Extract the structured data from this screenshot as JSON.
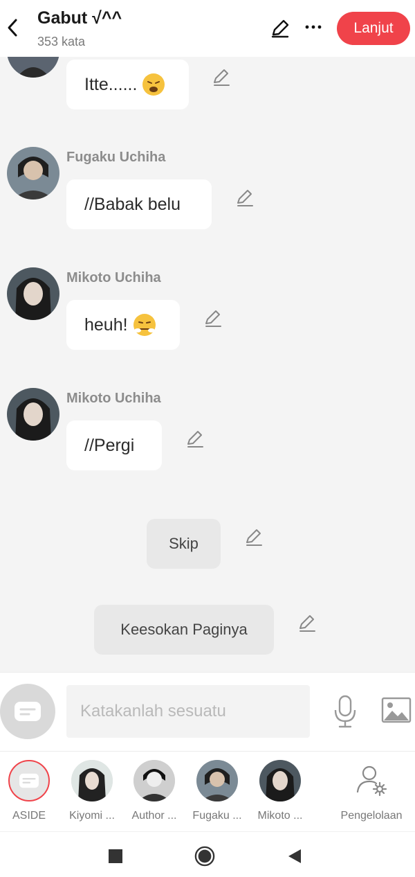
{
  "header": {
    "title": "Gabut √^^",
    "word_count": "353 kata",
    "next_label": "Lanjut"
  },
  "messages": [
    {
      "speaker": "",
      "text": "Itte......",
      "emoji": "weary-face"
    },
    {
      "speaker": "Fugaku Uchiha",
      "text": "//Babak belu"
    },
    {
      "speaker": "Mikoto Uchiha",
      "text": "heuh!",
      "emoji": "face-with-steam"
    },
    {
      "speaker": "Mikoto Uchiha",
      "text": "//Pergi"
    }
  ],
  "narrations": [
    {
      "text": "Skip"
    },
    {
      "text": "Keesokan Paginya"
    }
  ],
  "input": {
    "placeholder": "Katakanlah sesuatu"
  },
  "characters": [
    {
      "label": "ASIDE"
    },
    {
      "label": "Kiyomi ..."
    },
    {
      "label": "Author ..."
    },
    {
      "label": "Fugaku ..."
    },
    {
      "label": "Mikoto ..."
    },
    {
      "label": "Pengelolaan"
    }
  ],
  "colors": {
    "accent": "#f0434a",
    "background": "#f4f4f4",
    "bubble": "#ffffff",
    "narration": "#e8e8e8"
  }
}
